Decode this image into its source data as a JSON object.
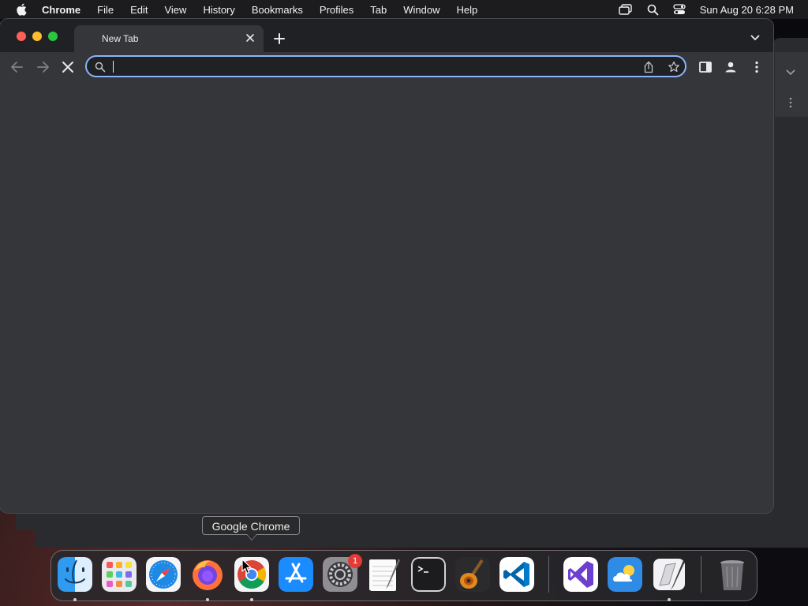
{
  "menubar": {
    "app_name": "Chrome",
    "items": [
      "File",
      "Edit",
      "View",
      "History",
      "Bookmarks",
      "Profiles",
      "Tab",
      "Window",
      "Help"
    ],
    "clock": "Sun Aug 20  6:28 PM"
  },
  "browser": {
    "tab_title": "New Tab",
    "omnibox_value": "",
    "content_background": "#35363a",
    "accent_color": "#8ab4f8"
  },
  "dock": {
    "tooltip": "Google Chrome",
    "apps": [
      {
        "name": "Finder",
        "icon": "finder-icon",
        "running": true
      },
      {
        "name": "Launchpad",
        "icon": "launchpad-icon",
        "running": false
      },
      {
        "name": "Safari",
        "icon": "safari-icon",
        "running": false
      },
      {
        "name": "Firefox",
        "icon": "firefox-icon",
        "running": true
      },
      {
        "name": "Google Chrome",
        "icon": "chrome-icon",
        "running": true
      },
      {
        "name": "App Store",
        "icon": "app-store-icon",
        "running": false
      },
      {
        "name": "System Settings",
        "icon": "system-settings-icon",
        "running": false,
        "badge": "1"
      },
      {
        "name": "TextEdit",
        "icon": "textedit-icon",
        "running": false
      },
      {
        "name": "Terminal",
        "icon": "terminal-icon",
        "running": false
      },
      {
        "name": "GarageBand",
        "icon": "garageband-icon",
        "running": false
      },
      {
        "name": "Visual Studio Code",
        "icon": "vscode-icon",
        "running": false
      },
      {
        "name": "Visual Studio",
        "icon": "visual-studio-icon",
        "running": false
      },
      {
        "name": "Weather",
        "icon": "weather-icon",
        "running": false
      },
      {
        "name": "Script Editor",
        "icon": "script-editor-icon",
        "running": true
      },
      {
        "name": "Trash",
        "icon": "trash-icon",
        "running": false
      }
    ]
  }
}
